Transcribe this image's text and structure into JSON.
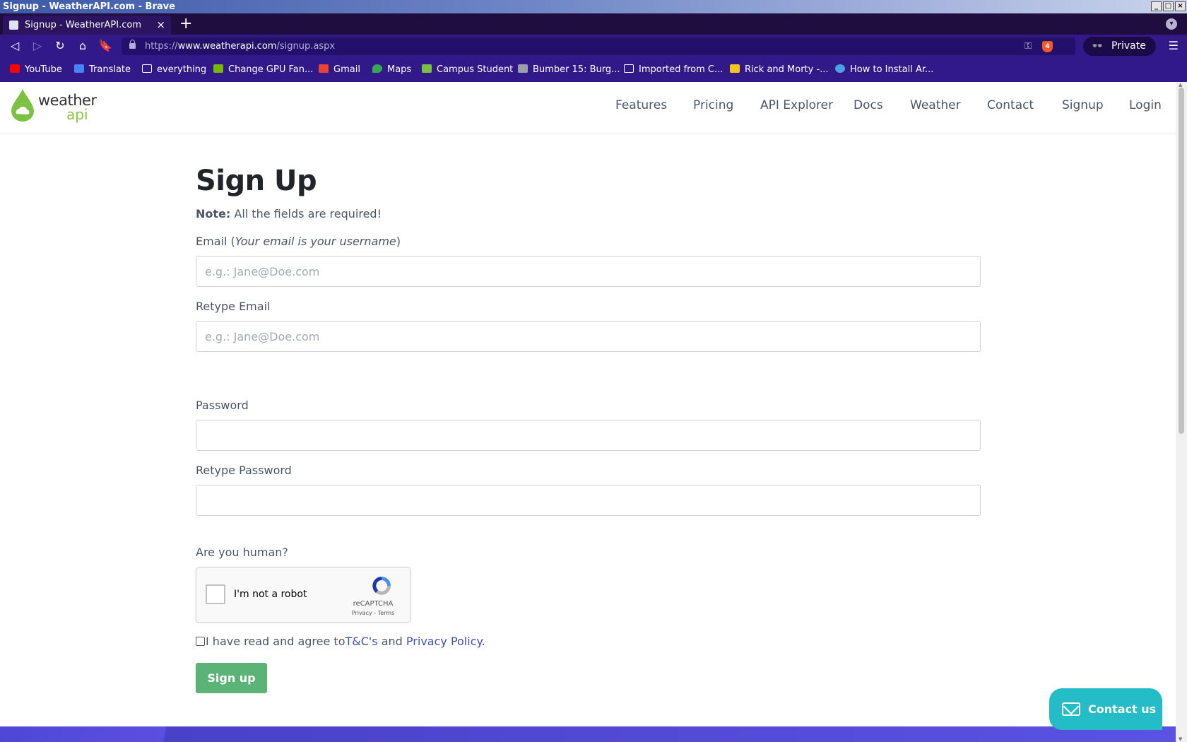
{
  "window": {
    "title": "Signup - WeatherAPI.com - Brave"
  },
  "tabs": [
    {
      "label": "Signup - WeatherAPI.com"
    }
  ],
  "toolbar": {
    "url_scheme": "https://",
    "url_host": "www.weatherapi.com",
    "url_path": "/signup.aspx",
    "shield_count": "4",
    "private_label": "Private"
  },
  "bookmarks": [
    {
      "label": "YouTube",
      "icon": "youtube-icon",
      "color": "#ff0000"
    },
    {
      "label": "Translate",
      "icon": "translate-icon",
      "color": "#4285f4"
    },
    {
      "label": "everything",
      "icon": "folder-icon",
      "color": "#ffffff"
    },
    {
      "label": "Change GPU Fan...",
      "icon": "nvidia-icon",
      "color": "#76b900"
    },
    {
      "label": "Gmail",
      "icon": "gmail-icon",
      "color": "#ea4335"
    },
    {
      "label": "Maps",
      "icon": "maps-icon",
      "color": "#34a853"
    },
    {
      "label": "Campus Student",
      "icon": "campus-icon",
      "color": "#7ac143"
    },
    {
      "label": "Bumber 15: Burg...",
      "icon": "cube-icon",
      "color": "#9aa0a6"
    },
    {
      "label": "Imported from C...",
      "icon": "folder-icon",
      "color": "#ffffff"
    },
    {
      "label": "Rick and Morty -...",
      "icon": "mf-icon",
      "color": "#f5c518"
    },
    {
      "label": "How to Install Ar...",
      "icon": "globe-icon",
      "color": "#4aa3df"
    }
  ],
  "site": {
    "logo_word": "weather",
    "logo_sub": "api",
    "nav": [
      "Features",
      "Pricing",
      "API Explorer",
      "Docs",
      "Weather",
      "Contact",
      "Signup",
      "Login"
    ]
  },
  "form": {
    "title": "Sign Up",
    "note_bold": "Note:",
    "note_text": " All the fields are required!",
    "email_label_prefix": "Email (",
    "email_label_italic": "Your email is your username",
    "email_label_suffix": ")",
    "email_placeholder": "e.g.: Jane@Doe.com",
    "retype_email_label": "Retype Email",
    "retype_email_placeholder": "e.g.: Jane@Doe.com",
    "password_label": "Password",
    "retype_password_label": "Retype Password",
    "human_label": "Are you human?",
    "captcha_label": "I'm not a robot",
    "captcha_brand": "reCAPTCHA",
    "captcha_links": "Privacy - Terms",
    "agree_prefix": "I have read and agree to",
    "agree_tc": "T&C's",
    "agree_and": " and ",
    "agree_privacy": "Privacy Policy",
    "agree_suffix": ".",
    "submit_label": "Sign up"
  },
  "contact_widget": {
    "label": "Contact us"
  },
  "colors": {
    "accent_purple": "#32198a",
    "link_blue": "#3f51b5",
    "button_green": "#5cb377",
    "contact_teal": "#23bcc7",
    "logo_green": "#8cc63f"
  }
}
